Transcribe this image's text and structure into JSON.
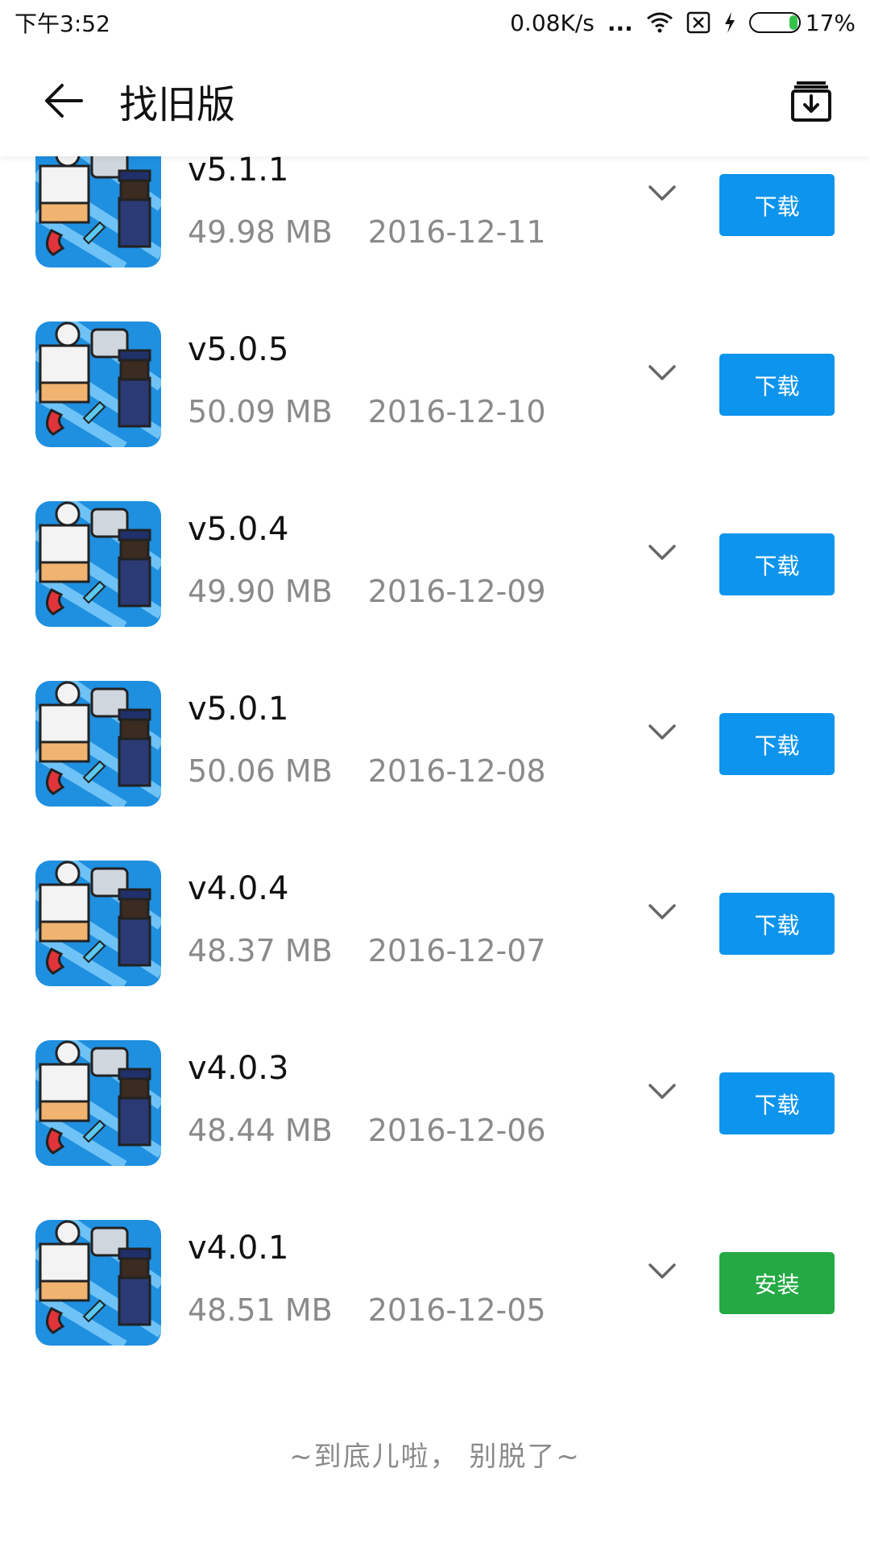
{
  "status_bar": {
    "time": "下午3:52",
    "net_speed": "0.08K/s",
    "more": "...",
    "battery_percent": "17%",
    "battery_level": 0.17
  },
  "app_bar": {
    "title": "找旧版"
  },
  "versions": [
    {
      "version": "v5.1.1",
      "size": "49.98 MB",
      "date": "2016-12-11",
      "action": "下载",
      "action_type": "download"
    },
    {
      "version": "v5.0.5",
      "size": "50.09 MB",
      "date": "2016-12-10",
      "action": "下载",
      "action_type": "download"
    },
    {
      "version": "v5.0.4",
      "size": "49.90 MB",
      "date": "2016-12-09",
      "action": "下载",
      "action_type": "download"
    },
    {
      "version": "v5.0.1",
      "size": "50.06 MB",
      "date": "2016-12-08",
      "action": "下载",
      "action_type": "download"
    },
    {
      "version": "v4.0.4",
      "size": "48.37 MB",
      "date": "2016-12-07",
      "action": "下载",
      "action_type": "download"
    },
    {
      "version": "v4.0.3",
      "size": "48.44 MB",
      "date": "2016-12-06",
      "action": "下载",
      "action_type": "download"
    },
    {
      "version": "v4.0.1",
      "size": "48.51 MB",
      "date": "2016-12-05",
      "action": "安装",
      "action_type": "install"
    }
  ],
  "footer": {
    "end_text": "~到底儿啦， 别脱了~"
  },
  "colors": {
    "download_button": "#0d94ec",
    "install_button": "#24a944",
    "meta_text": "#8a8a8a"
  }
}
